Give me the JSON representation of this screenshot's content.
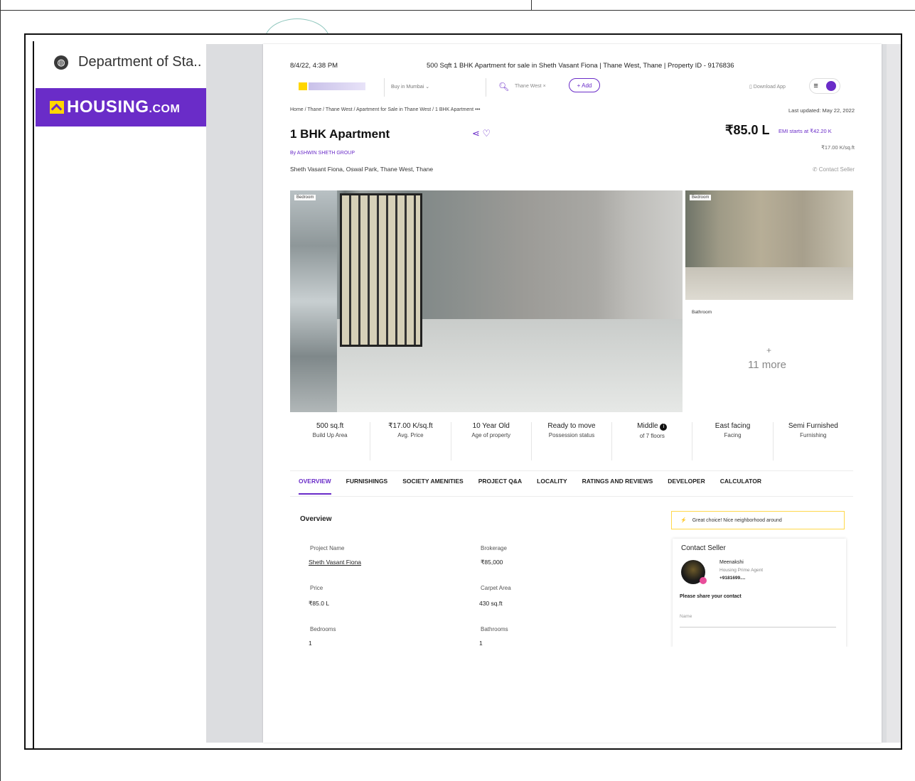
{
  "sidebar": {
    "department": "Department of Sta..",
    "logo": {
      "text": "HOUSING",
      "suffix": ".COM",
      "brand_color": "#6a2cc8",
      "accent": "#ffd600"
    }
  },
  "page": {
    "print_date": "8/4/22, 4:38 PM",
    "print_title": "500 Sqft 1 BHK Apartment for sale in Sheth Vasant Fiona | Thane West, Thane | Property ID - 9176836",
    "nav": {
      "buy_dropdown": "Buy in Mumbai",
      "search_chip": "Thane West",
      "add_button": "+ Add",
      "download_app": "Download App"
    },
    "breadcrumb": "Home / Thane / Thane West / Apartment for Sale in Thane West / 1 BHK Apartment",
    "breadcrumb_more": "•••",
    "last_updated": "Last updated: May 22, 2022",
    "title": "1 BHK Apartment",
    "price": "₹85.0 L",
    "emi": "EMI starts at ₹42.20 K",
    "by_label": "By",
    "by_name": "ASHWIN SHETH GROUP",
    "price_per_sqft": "₹17.00 K/sq.ft",
    "address": "Sheth Vasant Fiona, Oswal Park, Thane West, Thane",
    "contact_seller_top": "Contact Seller",
    "images": {
      "main_tag": "Bedroom",
      "side_tag": "Bedroom",
      "bathroom_label": "Bathroom",
      "more_plus": "+",
      "more_text": "11 more"
    },
    "stats": [
      {
        "value": "500 sq.ft",
        "label": "Build Up Area"
      },
      {
        "value": "₹17.00 K/sq.ft",
        "label": "Avg. Price"
      },
      {
        "value": "10 Year Old",
        "label": "Age of property"
      },
      {
        "value": "Ready to move",
        "label": "Possession status"
      },
      {
        "value": "Middle",
        "label": "of 7 floors"
      },
      {
        "value": "East facing",
        "label": "Facing"
      },
      {
        "value": "Semi Furnished",
        "label": "Furnishing"
      }
    ],
    "tabs": [
      "OVERVIEW",
      "FURNISHINGS",
      "SOCIETY AMENITIES",
      "PROJECT Q&A",
      "LOCALITY",
      "RATINGS AND REVIEWS",
      "DEVELOPER",
      "CALCULATOR"
    ],
    "overview": {
      "title": "Overview",
      "fields": [
        {
          "label": "Project Name",
          "value": "Sheth Vasant Fiona"
        },
        {
          "label": "Brokerage",
          "value": "₹85,000"
        },
        {
          "label": "Price",
          "value": "₹85.0 L"
        },
        {
          "label": "Carpet Area",
          "value": "430 sq.ft"
        },
        {
          "label": "Bedrooms",
          "value": "1"
        },
        {
          "label": "Bathrooms",
          "value": "1"
        }
      ]
    },
    "great_choice": "Great choice! Nice neighborhood around",
    "seller": {
      "title": "Contact Seller",
      "name": "Meenakshi",
      "agent": "Housing Prime Agent",
      "phone": "+9181699....",
      "share_contact": "Please share your contact",
      "name_placeholder": "Name"
    }
  }
}
